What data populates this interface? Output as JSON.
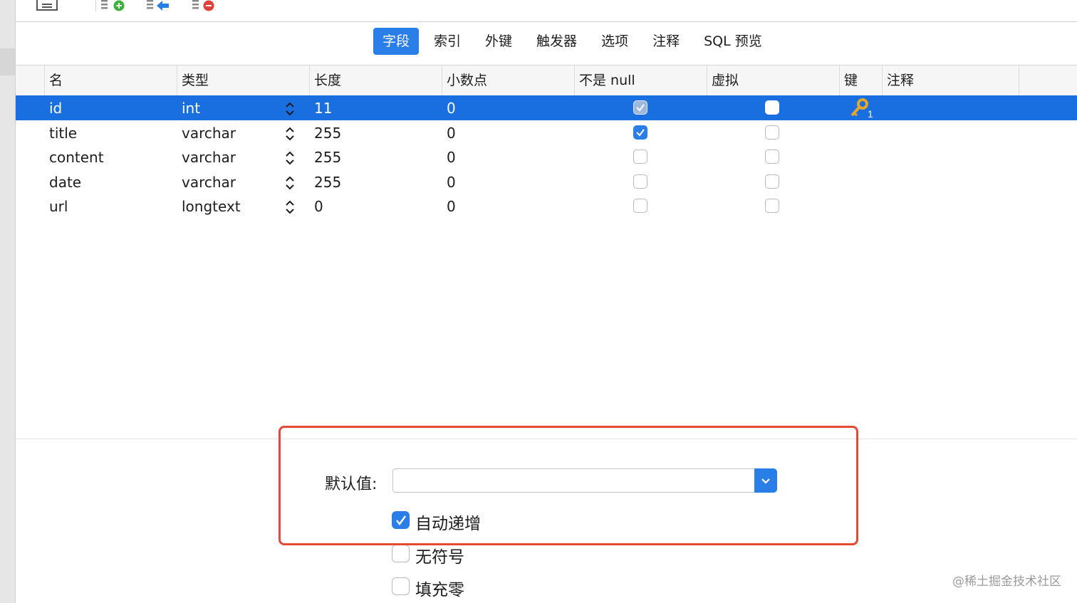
{
  "tabs": [
    {
      "label": "字段",
      "active": true
    },
    {
      "label": "索引",
      "active": false
    },
    {
      "label": "外键",
      "active": false
    },
    {
      "label": "触发器",
      "active": false
    },
    {
      "label": "选项",
      "active": false
    },
    {
      "label": "注释",
      "active": false
    },
    {
      "label": "SQL 预览",
      "active": false
    }
  ],
  "columns": [
    "名",
    "类型",
    "长度",
    "小数点",
    "不是 null",
    "虚拟",
    "键",
    "注释"
  ],
  "fields": [
    {
      "name": "id",
      "type": "int",
      "length": "11",
      "decimals": "0",
      "not_null": true,
      "virtual": false,
      "key": "1",
      "comment": ""
    },
    {
      "name": "title",
      "type": "varchar",
      "length": "255",
      "decimals": "0",
      "not_null": true,
      "virtual": false,
      "key": "",
      "comment": ""
    },
    {
      "name": "content",
      "type": "varchar",
      "length": "255",
      "decimals": "0",
      "not_null": false,
      "virtual": false,
      "key": "",
      "comment": ""
    },
    {
      "name": "date",
      "type": "varchar",
      "length": "255",
      "decimals": "0",
      "not_null": false,
      "virtual": false,
      "key": "",
      "comment": ""
    },
    {
      "name": "url",
      "type": "longtext",
      "length": "0",
      "decimals": "0",
      "not_null": false,
      "virtual": false,
      "key": "",
      "comment": ""
    }
  ],
  "selected_row": 0,
  "bottom": {
    "default_label": "默认值:",
    "default_value": "",
    "options": [
      {
        "label": "自动递增",
        "checked": true
      },
      {
        "label": "无符号",
        "checked": false
      },
      {
        "label": "填充零",
        "checked": false
      }
    ]
  },
  "colors": {
    "accent": "#2a7ee8",
    "selection": "#1a6fe0",
    "highlight_border": "#e64a35"
  },
  "watermark": "@稀土掘金技术社区"
}
